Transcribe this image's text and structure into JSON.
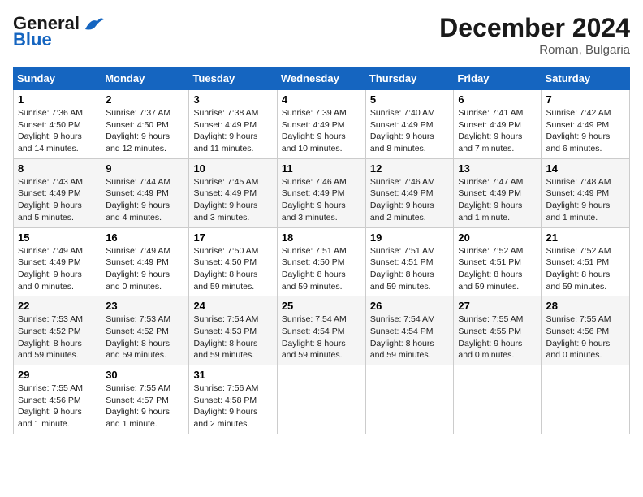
{
  "header": {
    "logo_line1": "General",
    "logo_line2": "Blue",
    "month": "December 2024",
    "location": "Roman, Bulgaria"
  },
  "days_of_week": [
    "Sunday",
    "Monday",
    "Tuesday",
    "Wednesday",
    "Thursday",
    "Friday",
    "Saturday"
  ],
  "weeks": [
    [
      {
        "day": "1",
        "info": "Sunrise: 7:36 AM\nSunset: 4:50 PM\nDaylight: 9 hours\nand 14 minutes."
      },
      {
        "day": "2",
        "info": "Sunrise: 7:37 AM\nSunset: 4:50 PM\nDaylight: 9 hours\nand 12 minutes."
      },
      {
        "day": "3",
        "info": "Sunrise: 7:38 AM\nSunset: 4:49 PM\nDaylight: 9 hours\nand 11 minutes."
      },
      {
        "day": "4",
        "info": "Sunrise: 7:39 AM\nSunset: 4:49 PM\nDaylight: 9 hours\nand 10 minutes."
      },
      {
        "day": "5",
        "info": "Sunrise: 7:40 AM\nSunset: 4:49 PM\nDaylight: 9 hours\nand 8 minutes."
      },
      {
        "day": "6",
        "info": "Sunrise: 7:41 AM\nSunset: 4:49 PM\nDaylight: 9 hours\nand 7 minutes."
      },
      {
        "day": "7",
        "info": "Sunrise: 7:42 AM\nSunset: 4:49 PM\nDaylight: 9 hours\nand 6 minutes."
      }
    ],
    [
      {
        "day": "8",
        "info": "Sunrise: 7:43 AM\nSunset: 4:49 PM\nDaylight: 9 hours\nand 5 minutes."
      },
      {
        "day": "9",
        "info": "Sunrise: 7:44 AM\nSunset: 4:49 PM\nDaylight: 9 hours\nand 4 minutes."
      },
      {
        "day": "10",
        "info": "Sunrise: 7:45 AM\nSunset: 4:49 PM\nDaylight: 9 hours\nand 3 minutes."
      },
      {
        "day": "11",
        "info": "Sunrise: 7:46 AM\nSunset: 4:49 PM\nDaylight: 9 hours\nand 3 minutes."
      },
      {
        "day": "12",
        "info": "Sunrise: 7:46 AM\nSunset: 4:49 PM\nDaylight: 9 hours\nand 2 minutes."
      },
      {
        "day": "13",
        "info": "Sunrise: 7:47 AM\nSunset: 4:49 PM\nDaylight: 9 hours\nand 1 minute."
      },
      {
        "day": "14",
        "info": "Sunrise: 7:48 AM\nSunset: 4:49 PM\nDaylight: 9 hours\nand 1 minute."
      }
    ],
    [
      {
        "day": "15",
        "info": "Sunrise: 7:49 AM\nSunset: 4:49 PM\nDaylight: 9 hours\nand 0 minutes."
      },
      {
        "day": "16",
        "info": "Sunrise: 7:49 AM\nSunset: 4:49 PM\nDaylight: 9 hours\nand 0 minutes."
      },
      {
        "day": "17",
        "info": "Sunrise: 7:50 AM\nSunset: 4:50 PM\nDaylight: 8 hours\nand 59 minutes."
      },
      {
        "day": "18",
        "info": "Sunrise: 7:51 AM\nSunset: 4:50 PM\nDaylight: 8 hours\nand 59 minutes."
      },
      {
        "day": "19",
        "info": "Sunrise: 7:51 AM\nSunset: 4:51 PM\nDaylight: 8 hours\nand 59 minutes."
      },
      {
        "day": "20",
        "info": "Sunrise: 7:52 AM\nSunset: 4:51 PM\nDaylight: 8 hours\nand 59 minutes."
      },
      {
        "day": "21",
        "info": "Sunrise: 7:52 AM\nSunset: 4:51 PM\nDaylight: 8 hours\nand 59 minutes."
      }
    ],
    [
      {
        "day": "22",
        "info": "Sunrise: 7:53 AM\nSunset: 4:52 PM\nDaylight: 8 hours\nand 59 minutes."
      },
      {
        "day": "23",
        "info": "Sunrise: 7:53 AM\nSunset: 4:52 PM\nDaylight: 8 hours\nand 59 minutes."
      },
      {
        "day": "24",
        "info": "Sunrise: 7:54 AM\nSunset: 4:53 PM\nDaylight: 8 hours\nand 59 minutes."
      },
      {
        "day": "25",
        "info": "Sunrise: 7:54 AM\nSunset: 4:54 PM\nDaylight: 8 hours\nand 59 minutes."
      },
      {
        "day": "26",
        "info": "Sunrise: 7:54 AM\nSunset: 4:54 PM\nDaylight: 8 hours\nand 59 minutes."
      },
      {
        "day": "27",
        "info": "Sunrise: 7:55 AM\nSunset: 4:55 PM\nDaylight: 9 hours\nand 0 minutes."
      },
      {
        "day": "28",
        "info": "Sunrise: 7:55 AM\nSunset: 4:56 PM\nDaylight: 9 hours\nand 0 minutes."
      }
    ],
    [
      {
        "day": "29",
        "info": "Sunrise: 7:55 AM\nSunset: 4:56 PM\nDaylight: 9 hours\nand 1 minute."
      },
      {
        "day": "30",
        "info": "Sunrise: 7:55 AM\nSunset: 4:57 PM\nDaylight: 9 hours\nand 1 minute."
      },
      {
        "day": "31",
        "info": "Sunrise: 7:56 AM\nSunset: 4:58 PM\nDaylight: 9 hours\nand 2 minutes."
      },
      null,
      null,
      null,
      null
    ]
  ]
}
